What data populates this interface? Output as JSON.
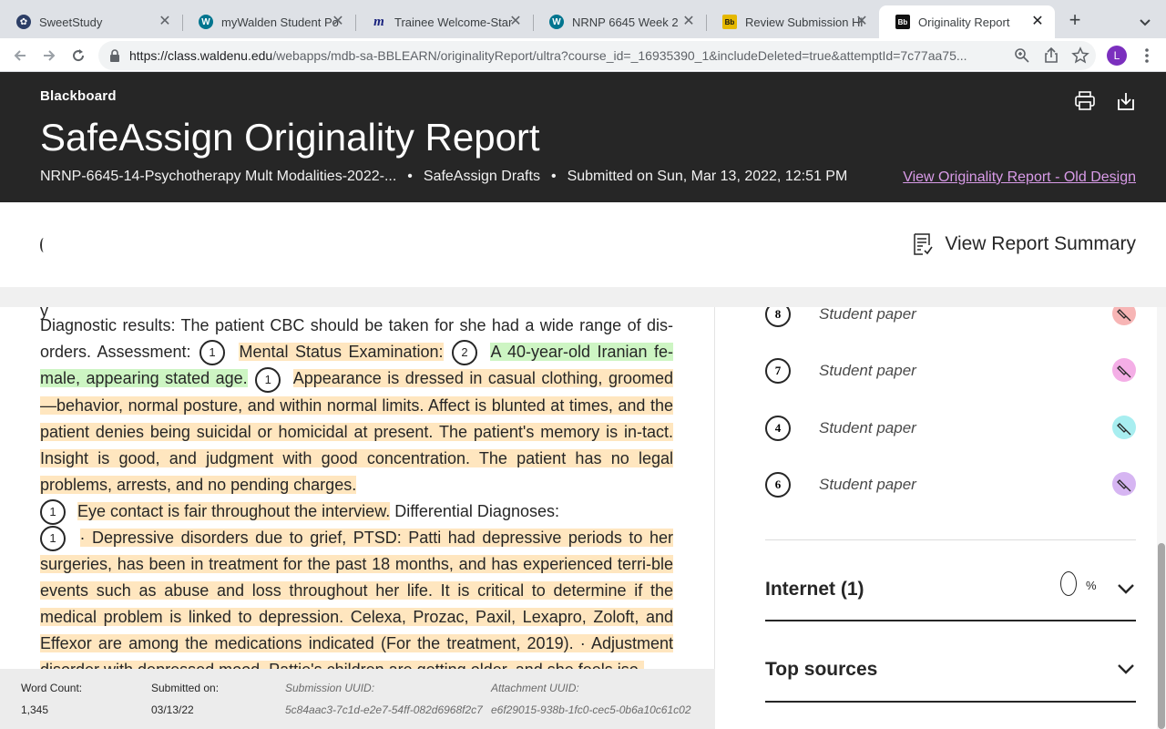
{
  "browser": {
    "tabs": [
      {
        "title": "SweetStudy",
        "icon": "sweetstudy-icon",
        "color": "#2c3e66",
        "glyph": "✿"
      },
      {
        "title": "myWalden Student Po",
        "icon": "walden-icon",
        "color": "#00758f",
        "glyph": "W"
      },
      {
        "title": "Trainee Welcome-Star",
        "icon": "m-logo-icon",
        "color": "#ffffff",
        "glyph": "m"
      },
      {
        "title": "NRNP 6645 Week 2",
        "icon": "walden-icon",
        "color": "#00758f",
        "glyph": "W"
      },
      {
        "title": "Review Submission Hi",
        "icon": "blackboard-icon",
        "color": "#e5b800",
        "glyph": "Bb"
      },
      {
        "title": "Originality Report",
        "icon": "blackboard-icon",
        "color": "#111111",
        "glyph": "Bb"
      }
    ],
    "active_tab": 5,
    "url_host": "https://class.waldenu.edu",
    "url_path": "/webapps/mdb-sa-BBLEARN/originalityReport/ultra?course_id=_16935390_1&includeDeleted=true&attemptId=7c77aa75...",
    "profile_initial": "L"
  },
  "header": {
    "brand": "Blackboard",
    "title": "SafeAssign Originality Report",
    "course": "NRNP-6645-14-Psychotherapy Mult Modalities-2022-...",
    "dot": "•",
    "drafts": "SafeAssign Drafts",
    "submitted": "Submitted on Sun, Mar 13, 2022, 12:51 PM",
    "old_design_link": "View Originality Report - Old Design"
  },
  "subbar": {
    "summary_label": "View Report Summary"
  },
  "document": {
    "p1_plain": "Diagnostic results: The patient CBC should be taken for she had a wide range of dis-orders. Assessment:",
    "m1": "1",
    "p1_hl": "Mental Status Examination:",
    "m2": "2",
    "p1_green": "A 40-year-old Iranian fe-male, appearing stated age.",
    "m3": "1",
    "p1_hl2": "Appearance is dressed in casual clothing, groomed —behavior, normal posture, and within normal limits. Affect is blunted at times, and the patient denies being suicidal or homicidal at present. The patient's memory is in-tact. Insight is good, and judgment with good concentration. The patient has no legal problems, arrests, and no pending charges.",
    "m4": "1",
    "p2_hl": "Eye contact is fair throughout the interview.",
    "p2_plain": "Differential Diagnoses:",
    "m5": "1",
    "p3_hl": "· Depressive disorders due to grief, PTSD: Patti had depressive periods to her surgeries, has been in treatment for the past 18 months, and has experienced terri-ble events such as abuse and loss throughout her life. It is critical to determine if the medical problem is linked to depression. Celexa, Prozac, Paxil, Lexapro, Zoloft, and Effexor are among the medications indicated (For the treatment, 2019). · Adjustment disorder with depressed mood. Pattie's children are getting older, and she feels iso-"
  },
  "footer": {
    "word_count_label": "Word Count:",
    "word_count": "1,345",
    "submitted_label": "Submitted on:",
    "submitted_date": "03/13/22",
    "submission_uuid_label": "Submission UUID:",
    "submission_uuid": "5c84aac3-7c1d-e2e7-54ff-082d6968f2c7",
    "attachment_uuid_label": "Attachment UUID:",
    "attachment_uuid": "e6f29015-938b-1fc0-cec5-0b6a10c61c02"
  },
  "sources": [
    {
      "num": "8",
      "name": "Student paper",
      "color": "#f7b5b5"
    },
    {
      "num": "7",
      "name": "Student paper",
      "color": "#f4aee6"
    },
    {
      "num": "4",
      "name": "Student paper",
      "color": "#a8eef0"
    },
    {
      "num": "6",
      "name": "Student paper",
      "color": "#d6b5f2"
    }
  ],
  "internet": {
    "label": "Internet (1)",
    "percent_sign": "%"
  },
  "top_sources": {
    "label": "Top sources"
  }
}
